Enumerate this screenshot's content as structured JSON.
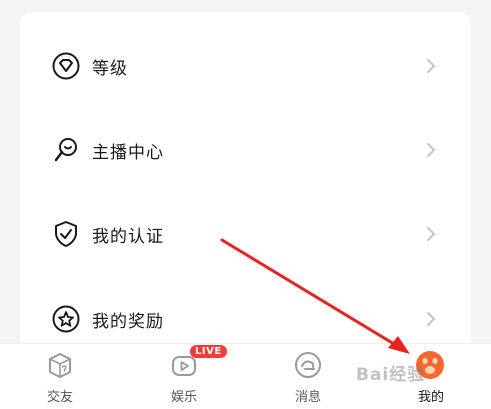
{
  "menu": {
    "items": [
      {
        "label": "等级",
        "icon": "level-gem-icon"
      },
      {
        "label": "主播中心",
        "icon": "streamer-microphone-icon"
      },
      {
        "label": "我的认证",
        "icon": "shield-check-icon"
      },
      {
        "label": "我的奖励",
        "icon": "reward-star-icon"
      }
    ]
  },
  "tabbar": {
    "tabs": [
      {
        "label": "交友",
        "icon": "box-question-icon"
      },
      {
        "label": "娱乐",
        "icon": "tv-play-icon",
        "badge": "LIVE"
      },
      {
        "label": "消息",
        "icon": "message-bubble-icon"
      },
      {
        "label": "我的",
        "icon": "profile-paw-icon",
        "active": true
      }
    ]
  },
  "watermark": {
    "text": "Bai经验"
  },
  "colors": {
    "accent": "#f5672a",
    "badge": "#f23c3c",
    "arrow": "#e8231e",
    "text": "#1a1a1a",
    "muted": "#555555"
  }
}
